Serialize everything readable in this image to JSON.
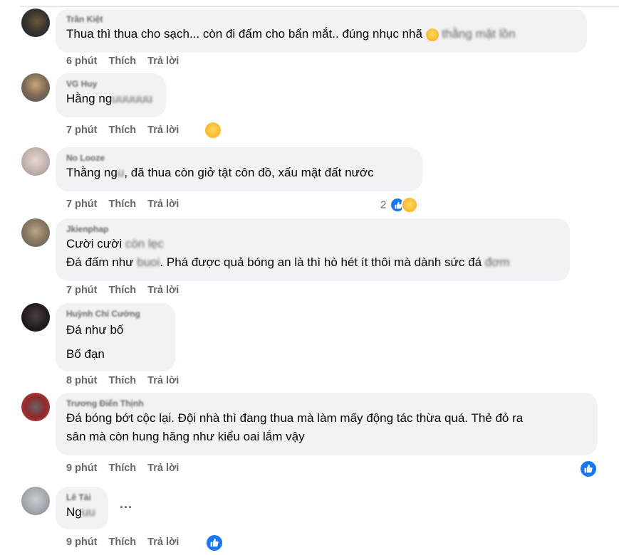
{
  "comments": [
    {
      "name": "Trần Kiệt",
      "lines": [
        {
          "text": "Thua thì thua cho sạch... còn đi đấm cho bẩn mắt.. đúng nhục nhã ",
          "blur": "thằng mặt lồn"
        }
      ],
      "time": "6 phút"
    },
    {
      "name": "VG Huy",
      "lines": [
        {
          "text": "Hằng ng",
          "blur": "uuuuuu"
        }
      ],
      "time": "7 phút"
    },
    {
      "name": "No Looze",
      "lines": [
        {
          "text": "Thằng ng",
          "blur": "u",
          "text2": ", đã thua còn giở tật côn đồ, xấu mặt đất nước"
        }
      ],
      "time": "7 phút",
      "reaction_count": "2"
    },
    {
      "name": "Jkienphap",
      "lines": [
        {
          "text": "Cười cười ",
          "blur": "còn lẹc"
        },
        {
          "text": "Đá đấm như ",
          "blur": "buoi",
          "text2": ". Phá được quả bóng an là thì hò hét ít thôi mà dành sức đá ",
          "blur2": "đơm"
        }
      ],
      "time": "7 phút"
    },
    {
      "name": "Huỳnh Chí Cường",
      "lines": [
        {
          "text": "Đá như bố"
        },
        {
          "text": "Bố đạn"
        }
      ],
      "time": "8 phút"
    },
    {
      "name": "Trương Điển Thịnh",
      "lines": [
        {
          "text": "Đá bóng bớt cộc lại. Đội nhà thì đang thua mà làm mấy động tác thừa quá. Thẻ đỏ ra"
        },
        {
          "text": "sân mà còn hung hăng như kiểu oai lắm vậy"
        }
      ],
      "time": "9 phút"
    },
    {
      "name": "Lê Tài",
      "lines": [
        {
          "text": "Ng",
          "blur": "uu"
        }
      ],
      "time": "9 phút"
    }
  ],
  "labels": {
    "like": "Thích",
    "reply": "Trả lời",
    "more": "..."
  },
  "colors": {
    "bubble": "#f0f2f5",
    "meta": "#65676b",
    "like_blue": "#1877f2",
    "emoji": "#f7b125"
  }
}
